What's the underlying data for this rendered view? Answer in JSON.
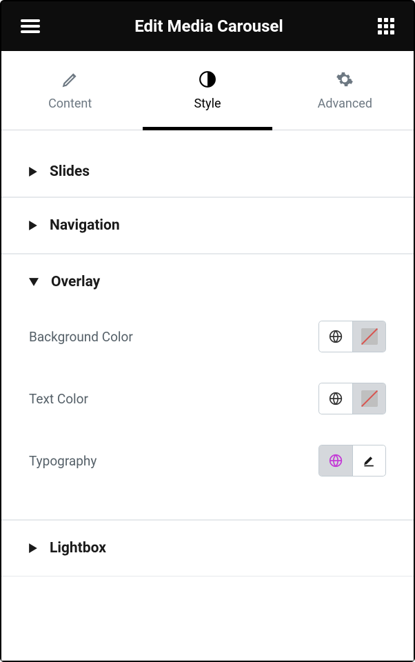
{
  "header": {
    "title": "Edit Media Carousel"
  },
  "tabs": {
    "content": "Content",
    "style": "Style",
    "advanced": "Advanced",
    "active": "style"
  },
  "sections": {
    "slides": {
      "title": "Slides",
      "expanded": false
    },
    "navigation": {
      "title": "Navigation",
      "expanded": false
    },
    "overlay": {
      "title": "Overlay",
      "expanded": true,
      "controls": {
        "background_color": {
          "label": "Background Color"
        },
        "text_color": {
          "label": "Text Color"
        },
        "typography": {
          "label": "Typography"
        }
      }
    },
    "lightbox": {
      "title": "Lightbox",
      "expanded": false
    }
  }
}
